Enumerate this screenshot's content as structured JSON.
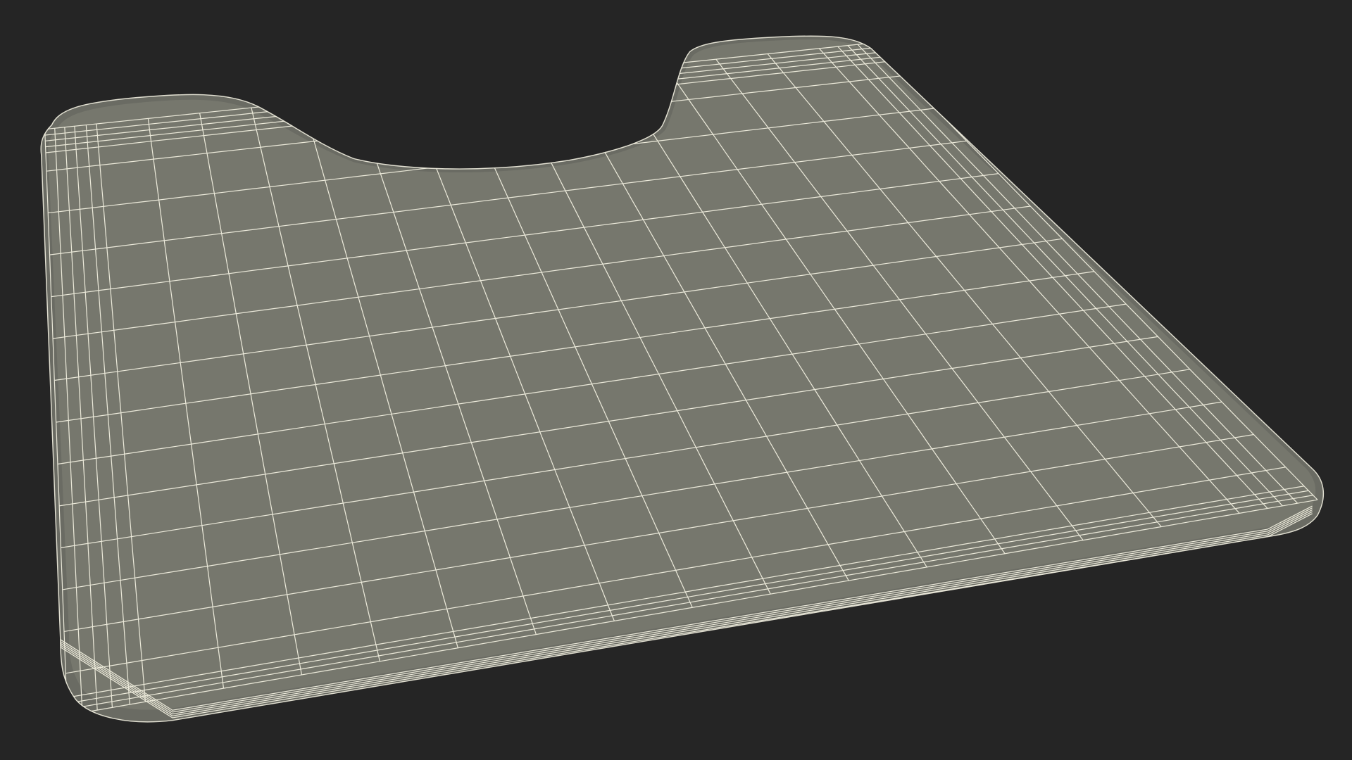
{
  "scene": {
    "subject": "wireframe-mesh",
    "colors": {
      "background": "#252525",
      "surface": "#76776d",
      "surface_edge": "#6a6b63",
      "wire": "#f2f0e0"
    }
  }
}
